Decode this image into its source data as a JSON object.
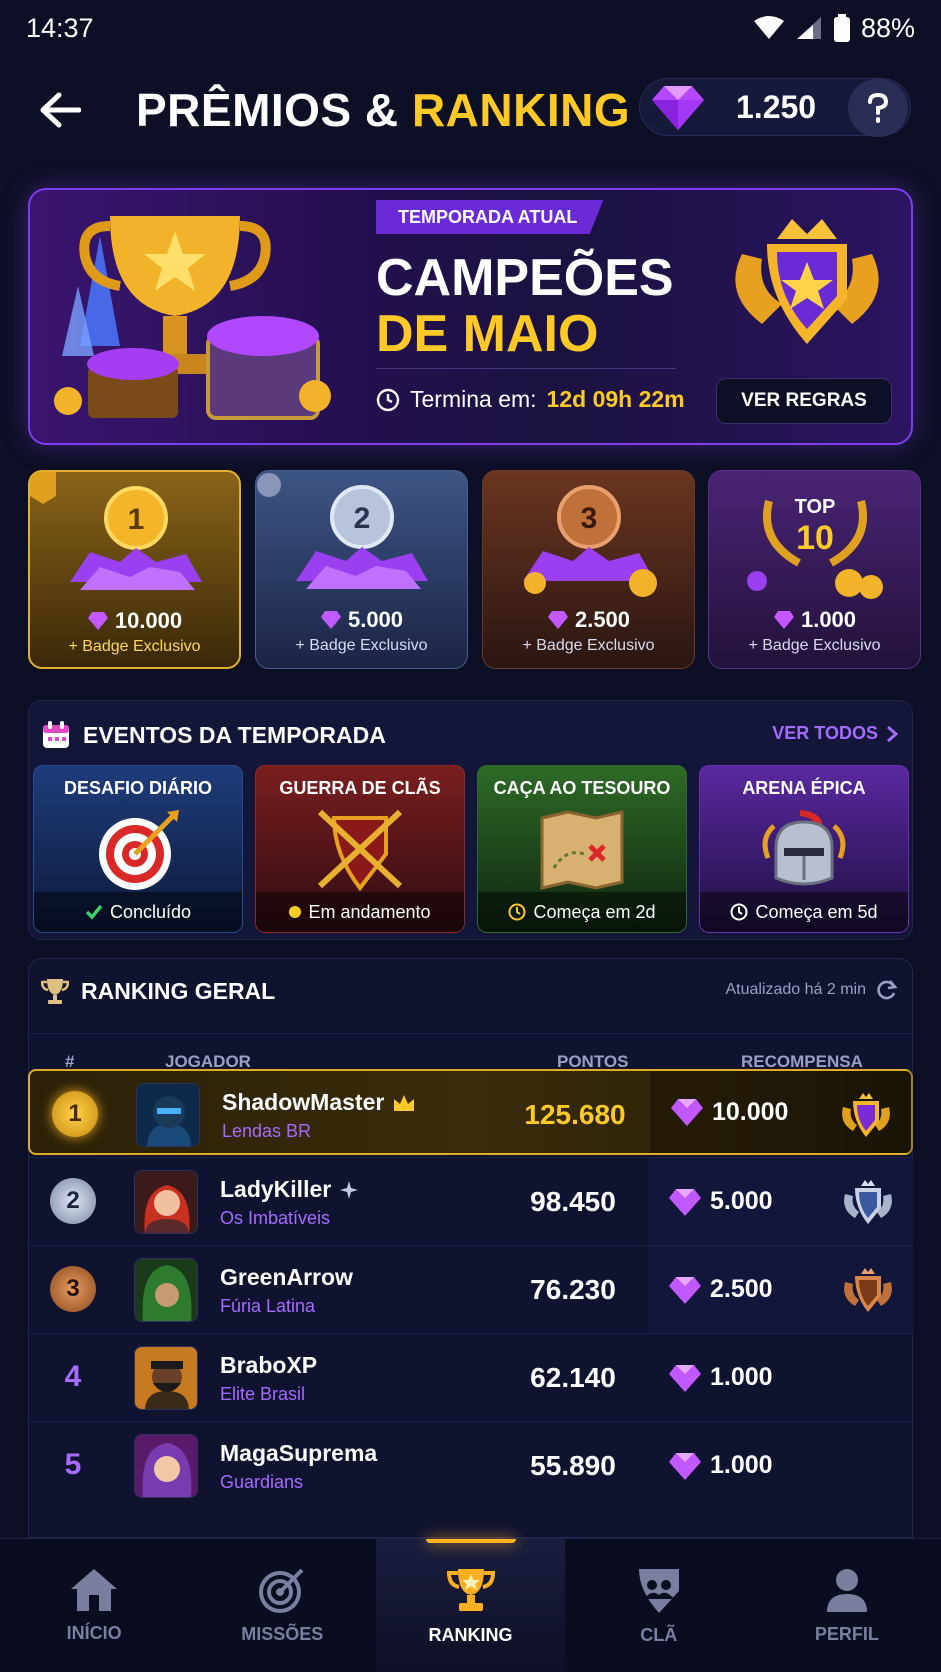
{
  "status_bar": {
    "time": "14:37",
    "battery": "88%"
  },
  "header": {
    "title_part1": "PRÊMIOS & ",
    "title_part2": "RANKING",
    "gem_balance": "1.250"
  },
  "season_banner": {
    "tag": "TEMPORADA ATUAL",
    "title_line1": "CAMPEÕES",
    "title_line2": "DE MAIO",
    "ends_label": "Termina em:",
    "ends_time": "12d 09h 22m",
    "rules_button": "VER REGRAS"
  },
  "prizes": [
    {
      "rank_label": "1",
      "amount": "10.000",
      "extra": "+ Badge Exclusivo"
    },
    {
      "rank_label": "2",
      "amount": "5.000",
      "extra": "+ Badge Exclusivo"
    },
    {
      "rank_label": "3",
      "amount": "2.500",
      "extra": "+ Badge Exclusivo"
    },
    {
      "rank_label_top": "TOP",
      "rank_label": "10",
      "amount": "1.000",
      "extra": "+ Badge Exclusivo"
    }
  ],
  "events": {
    "title": "EVENTOS DA TEMPORADA",
    "see_all": "VER TODOS",
    "items": [
      {
        "name": "DESAFIO DIÁRIO",
        "status": "Concluído",
        "status_icon": "check-icon"
      },
      {
        "name": "GUERRA DE CLÃS",
        "status": "Em andamento",
        "status_icon": "dot-icon"
      },
      {
        "name": "CAÇA AO TESOURO",
        "status": "Começa em 2d",
        "status_icon": "clock-icon"
      },
      {
        "name": "ARENA ÉPICA",
        "status": "Começa em 5d",
        "status_icon": "clock-icon"
      }
    ]
  },
  "ranking": {
    "title": "RANKING GERAL",
    "updated": "Atualizado há 2 min",
    "columns": {
      "rank": "#",
      "player": "JOGADOR",
      "points": "PONTOS",
      "reward": "RECOMPENSA"
    },
    "rows": [
      {
        "rank": "1",
        "name": "ShadowMaster",
        "clan": "Lendas BR",
        "points": "125.680",
        "reward": "10.000"
      },
      {
        "rank": "2",
        "name": "LadyKiller",
        "clan": "Os Imbatíveis",
        "points": "98.450",
        "reward": "5.000"
      },
      {
        "rank": "3",
        "name": "GreenArrow",
        "clan": "Fúria Latina",
        "points": "76.230",
        "reward": "2.500"
      },
      {
        "rank": "4",
        "name": "BraboXP",
        "clan": "Elite Brasil",
        "points": "62.140",
        "reward": "1.000"
      },
      {
        "rank": "5",
        "name": "MagaSuprema",
        "clan": "Guardians",
        "points": "55.890",
        "reward": "1.000"
      }
    ]
  },
  "tabs": [
    {
      "label": "INÍCIO",
      "icon": "home-icon"
    },
    {
      "label": "MISSÕES",
      "icon": "target-icon"
    },
    {
      "label": "RANKING",
      "icon": "trophy-icon",
      "active": true
    },
    {
      "label": "CLÃ",
      "icon": "clan-shield-icon"
    },
    {
      "label": "PERFIL",
      "icon": "user-icon"
    }
  ],
  "colors": {
    "accent_gold": "#ffc928",
    "accent_purple": "#a56bff",
    "background": "#0d0f24"
  }
}
